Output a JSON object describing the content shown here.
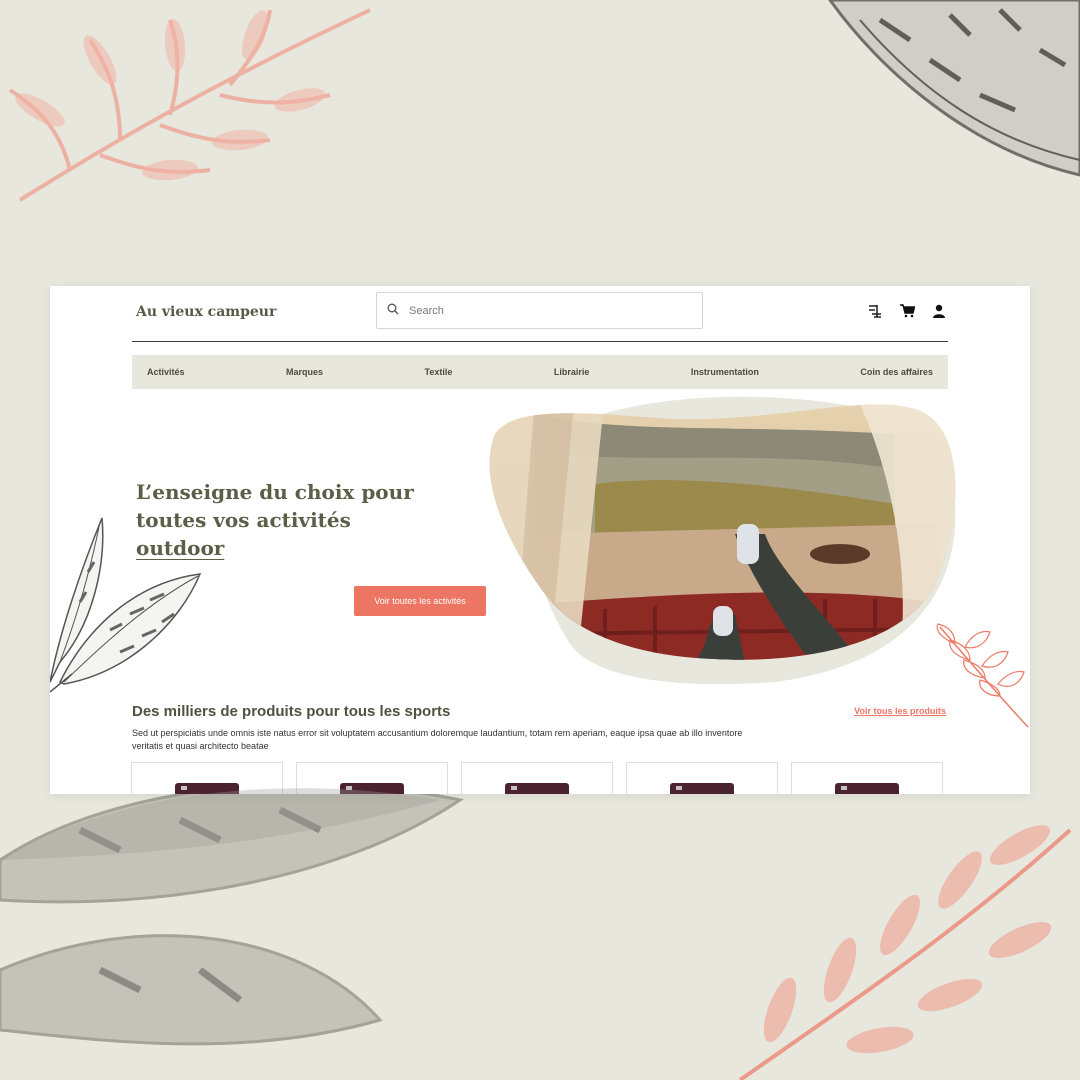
{
  "site": {
    "logo": "Au vieux campeur"
  },
  "search": {
    "placeholder": "Search",
    "value": ""
  },
  "header_icons": [
    "filter-icon",
    "cart-icon",
    "user-icon"
  ],
  "nav": {
    "items": [
      "Activités",
      "Marques",
      "Textile",
      "Librairie",
      "Instrumentation",
      "Coin des affaires"
    ]
  },
  "hero": {
    "title_line1": "L’enseigne du choix pour",
    "title_line2": "toutes vos activités",
    "title_highlight": "outdoor",
    "cta_label": "Voir toutes les activités"
  },
  "products": {
    "title": "Des milliers de produits pour tous les sports",
    "link_label": "Voir tous les produits",
    "description": "Sed ut perspiciatis unde omnis iste natus error sit voluptatem accusantium doloremque laudantium, totam rem aperiam, eaque ipsa quae ab illo inventore veritatis et quasi architecto beatae",
    "cards_count_visible": 5
  },
  "colors": {
    "background": "#e7e7dd",
    "accent": "#ec7563",
    "olive_text": "#5a5f47",
    "nav_bg": "#e7e7dd"
  }
}
